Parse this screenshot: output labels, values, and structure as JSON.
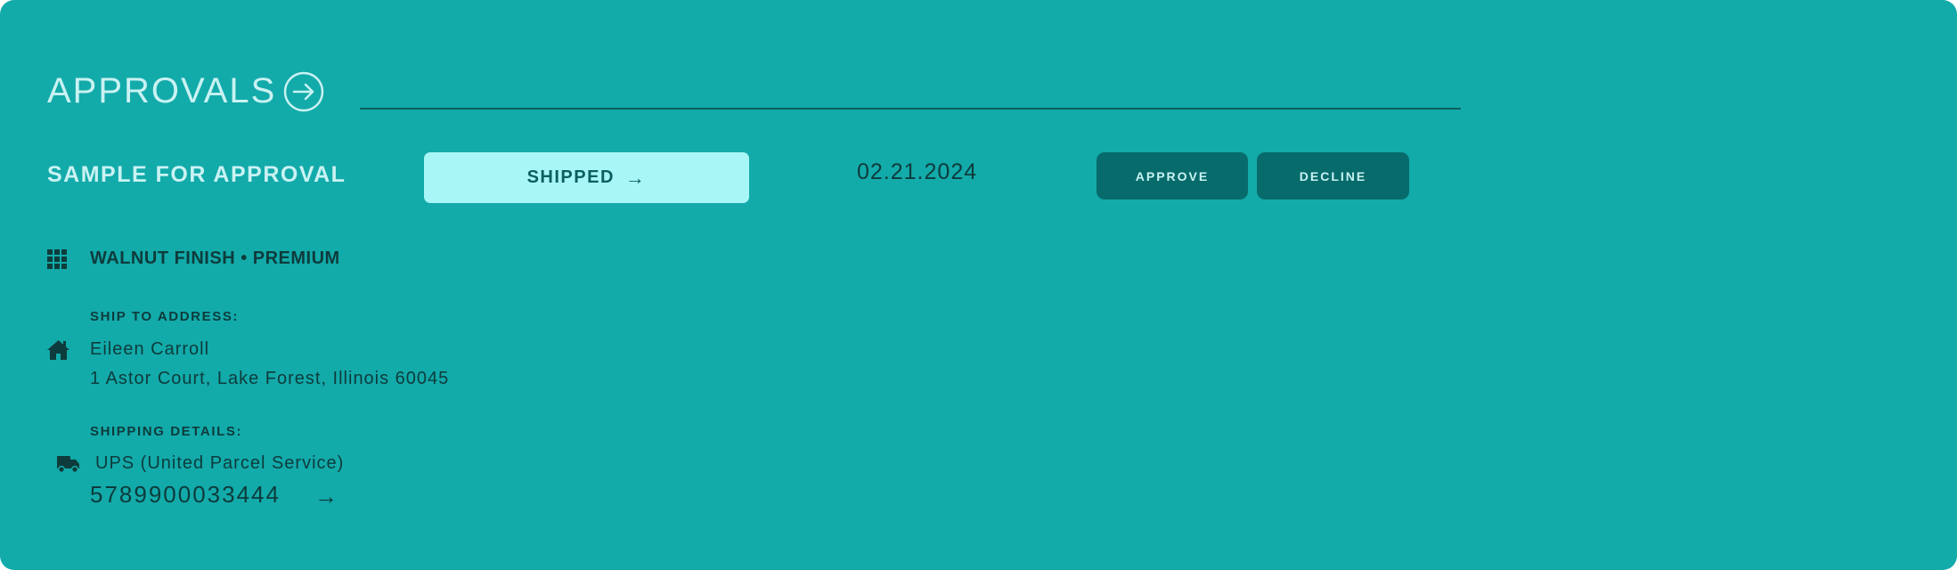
{
  "header": {
    "title": "APPROVALS",
    "arrow_icon": "arrow-right-circle-icon"
  },
  "colors": {
    "card_bg": "#13aaaa",
    "shipped_bg": "#a9f6f6",
    "action_bg": "#076b6b",
    "text_dark": "#0e3b3b",
    "text_light": "#c9f2f2"
  },
  "item": {
    "label": "SAMPLE FOR APPROVAL",
    "status_label": "SHIPPED",
    "status_arrow": "→",
    "date": "02.21.2024",
    "approve_label": "APPROVE",
    "decline_label": "DECLINE",
    "finish": "WALNUT FINISH • PREMIUM",
    "ship_to_heading": "SHIP TO ADDRESS:",
    "recipient_name": "Eileen Carroll",
    "address": "1 Astor Court, Lake Forest, Illinois 60045",
    "shipping_heading": "SHIPPING DETAILS:",
    "carrier": "UPS (United Parcel Service)",
    "tracking_number": "5789900033444",
    "tracking_arrow": "→"
  },
  "icons": {
    "finish": "grid-icon",
    "address": "home-icon",
    "shipping": "truck-icon"
  }
}
